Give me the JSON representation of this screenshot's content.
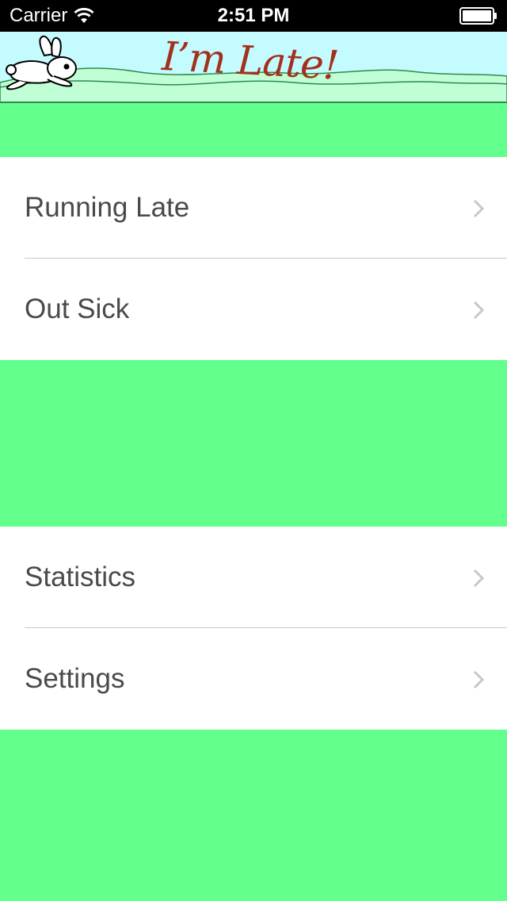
{
  "status_bar": {
    "carrier": "Carrier",
    "time": "2:51 PM"
  },
  "banner": {
    "title": "I’m Late!",
    "title_color": "#a3301c",
    "sky_color": "#c4fbff",
    "hill_color": "#c0ffd6",
    "logo_icon": "rabbit-icon"
  },
  "menu": {
    "group_1": [
      {
        "label": "Running Late",
        "icon": "chevron-right-icon"
      },
      {
        "label": "Out Sick",
        "icon": "chevron-right-icon"
      }
    ],
    "group_2": [
      {
        "label": "Statistics",
        "icon": "chevron-right-icon"
      },
      {
        "label": "Settings",
        "icon": "chevron-right-icon"
      }
    ]
  },
  "colors": {
    "background": "#62ff8d",
    "cell_background": "#ffffff",
    "label": "#4a4a4a",
    "chevron": "#c7c7cc"
  }
}
